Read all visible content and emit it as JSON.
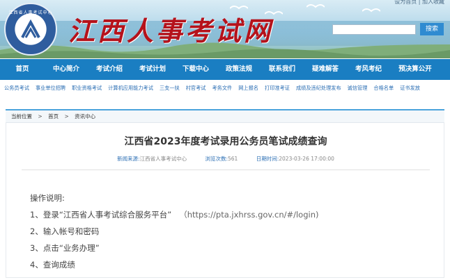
{
  "header": {
    "site_title": "江西人事考试网",
    "emblem_text": "江西省人事考试中心",
    "toplinks": "设为首页 | 加入收藏",
    "search_placeholder": "",
    "search_button": "搜索"
  },
  "nav": {
    "items": [
      "首页",
      "中心简介",
      "考试介绍",
      "考试计划",
      "下载中心",
      "政策法规",
      "联系我们",
      "疑难解答",
      "考风考纪",
      "预决算公开"
    ]
  },
  "subnav": {
    "items": [
      "公务员考试",
      "事业单位招聘",
      "职业资格考试",
      "计算机应用能力考试",
      "三支一扶",
      "村官考试",
      "考务文件",
      "网上报名",
      "打印准考证",
      "成绩及违纪处理发布",
      "诚信管理",
      "合格名单",
      "证书发放"
    ]
  },
  "breadcrumb": {
    "label": "当前位置",
    "items": [
      "首页",
      "资讯中心"
    ],
    "separator": ">"
  },
  "article": {
    "title": "江西省2023年度考试录用公务员笔试成绩查询",
    "source_label": "新闻来源:",
    "source": "江西省人事考试中心",
    "views_label": "浏览次数:",
    "views": "561",
    "date_label": "日期时间:",
    "date": "2023-03-26 17:00:00",
    "lines": [
      "操作说明:",
      "1、登录“江西省人事考试综合服务平台”",
      "2、输入帐号和密码",
      "3、点击“业务办理”",
      "4、查询成绩"
    ],
    "url": "（https://pta.jxhrss.gov.cn/#/login)"
  },
  "colors": {
    "nav_bg": "#1a7ec2",
    "title_red": "#b5121b",
    "link_blue": "#2c6fb4",
    "accent": "#4aa3dc"
  }
}
